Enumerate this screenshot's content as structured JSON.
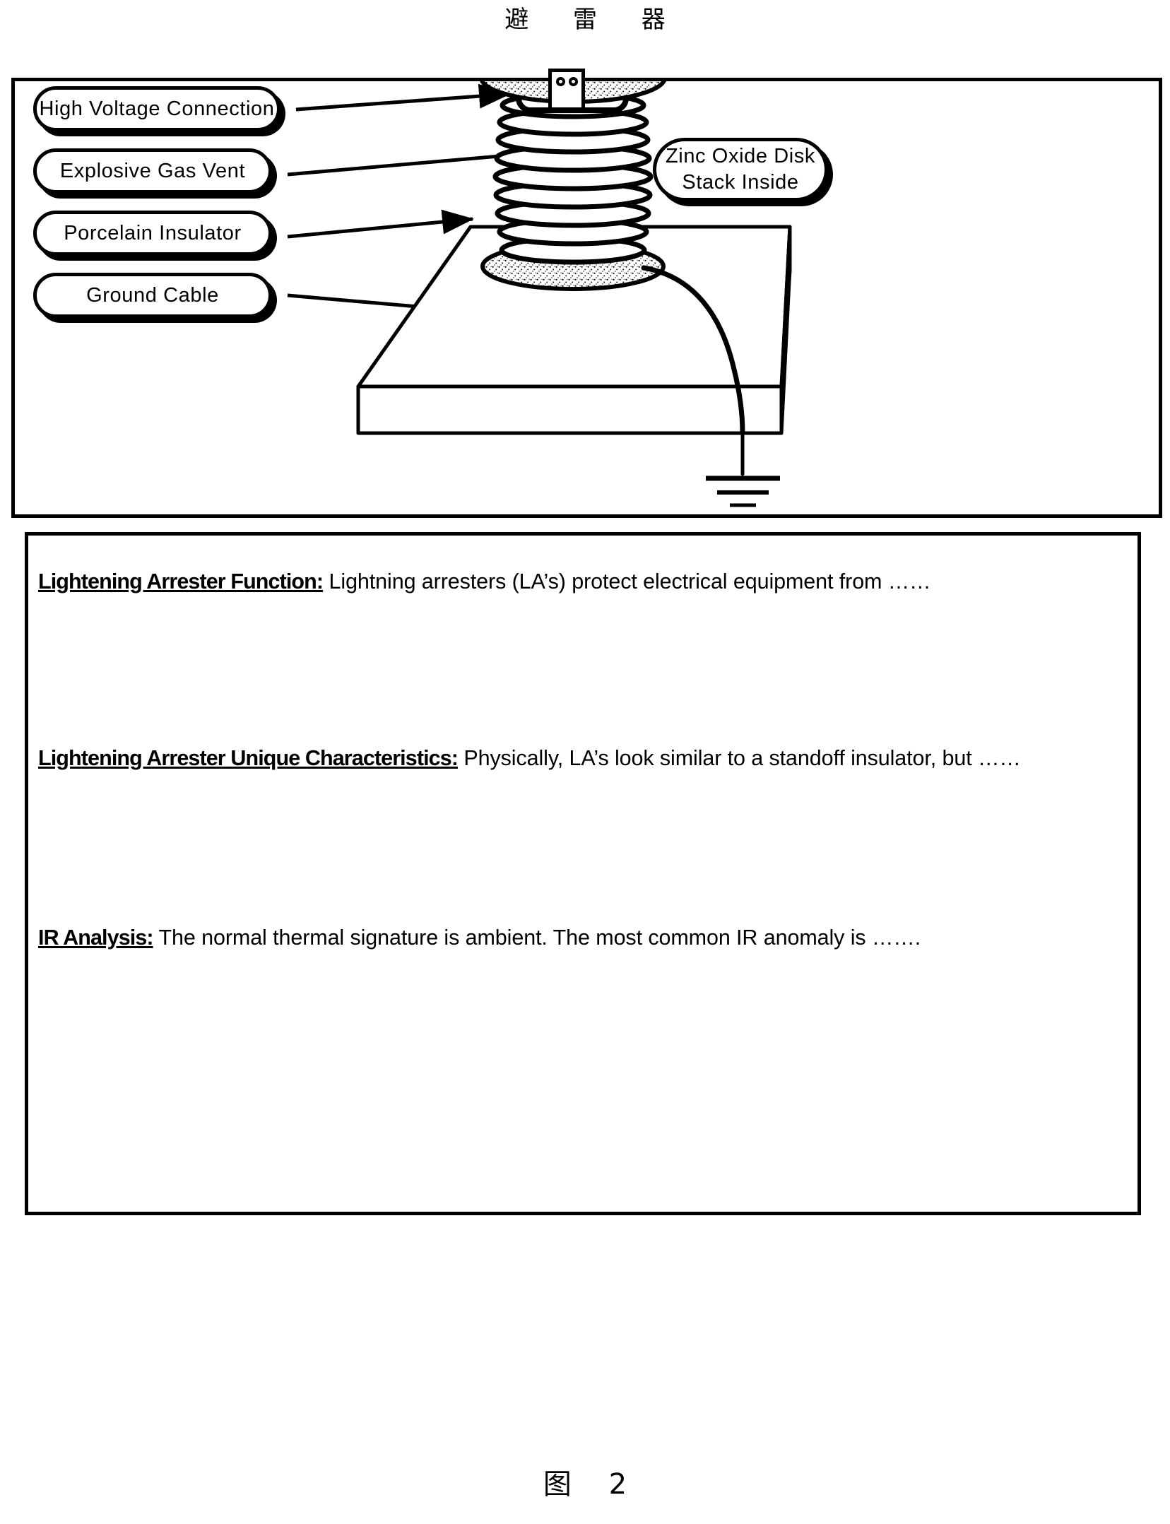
{
  "page": {
    "title": "避 雷 器",
    "figure_caption": "图 2",
    "background_color": "#ffffff",
    "ink_color": "#000000"
  },
  "diagram": {
    "panel_name": "lightning-arrester-diagram",
    "callouts": [
      {
        "id": "high-voltage-connection",
        "label": "High Voltage Connection",
        "side": "left"
      },
      {
        "id": "explosive-gas-vent",
        "label": "Explosive Gas Vent",
        "side": "left"
      },
      {
        "id": "porcelain-insulator",
        "label": "Porcelain Insulator",
        "side": "left"
      },
      {
        "id": "ground-cable",
        "label": "Ground Cable",
        "side": "left"
      }
    ],
    "zinc_callout": {
      "id": "zinc-oxide-disk-stack",
      "line1": "Zinc Oxide Disk",
      "line2": "Stack Inside"
    },
    "illustration_parts": [
      "terminal-cap",
      "top-flange-stippled",
      "gas-vent-ring",
      "porcelain-shed-stack",
      "bottom-flange-stippled",
      "concrete-pad-slab",
      "ground-cable-curve",
      "earth-ground-symbol"
    ],
    "shed_count": 9
  },
  "text_panel": {
    "paragraphs": [
      {
        "id": "lightening-arrester-function",
        "lead": "Lightening Arrester Function:",
        "body": " Lightning arresters (LA’s) protect electrical equipment from ……"
      },
      {
        "id": "lightening-arrester-unique-characteristics",
        "lead": "Lightening Arrester Unique Characteristics:",
        "body": " Physically, LA’s look similar to a standoff insulator, but ……"
      },
      {
        "id": "ir-analysis",
        "lead": "IR Analysis:",
        "body": " The normal thermal signature is ambient.  The most common IR anomaly is ……."
      }
    ]
  }
}
